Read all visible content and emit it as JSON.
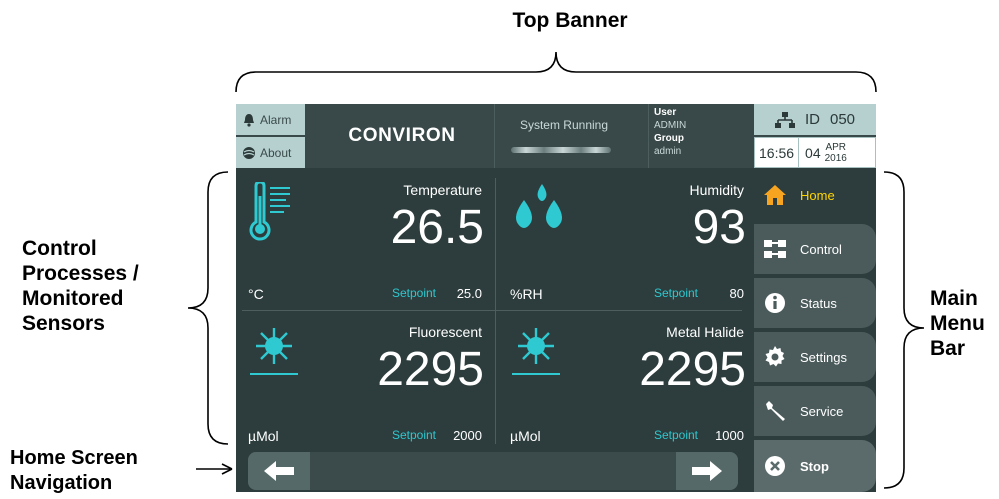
{
  "annotations": {
    "top_banner": "Top Banner",
    "control_processes": [
      "Control",
      "Processes /",
      "Monitored",
      "Sensors"
    ],
    "main_menu_bar": [
      "Main",
      "Menu",
      "Bar"
    ],
    "home_navigation": [
      "Home Screen",
      "Navigation"
    ]
  },
  "banner": {
    "alarm_label": "Alarm",
    "about_label": "About",
    "logo_text": "CONVIRON",
    "system_status": "System Running",
    "user_label": "User",
    "user_value": "ADMIN",
    "group_label": "Group",
    "group_value": "admin",
    "id_label": "ID",
    "id_value": "050",
    "time": "16:56",
    "day": "04",
    "month": "APR",
    "year": "2016"
  },
  "sensors": {
    "temperature": {
      "label": "Temperature",
      "value": "26.5",
      "unit": "°C",
      "setpoint_label": "Setpoint",
      "setpoint": "25.0"
    },
    "humidity": {
      "label": "Humidity",
      "value": "93",
      "unit": "%RH",
      "setpoint_label": "Setpoint",
      "setpoint": "80"
    },
    "fluorescent": {
      "label": "Fluorescent",
      "value": "2295",
      "unit": "µMol",
      "setpoint_label": "Setpoint",
      "setpoint": "2000"
    },
    "metal_halide": {
      "label": "Metal Halide",
      "value": "2295",
      "unit": "µMol",
      "setpoint_label": "Setpoint",
      "setpoint": "1000"
    }
  },
  "menu": {
    "home": "Home",
    "control": "Control",
    "status": "Status",
    "settings": "Settings",
    "service": "Service",
    "stop": "Stop"
  },
  "colors": {
    "accent_cyan": "#2ec9d1",
    "active_yellow": "#ffd500",
    "home_icon_orange": "#f7a520",
    "screen_background": "#2d3c3c",
    "banner_pale": "#b6d0d0"
  }
}
